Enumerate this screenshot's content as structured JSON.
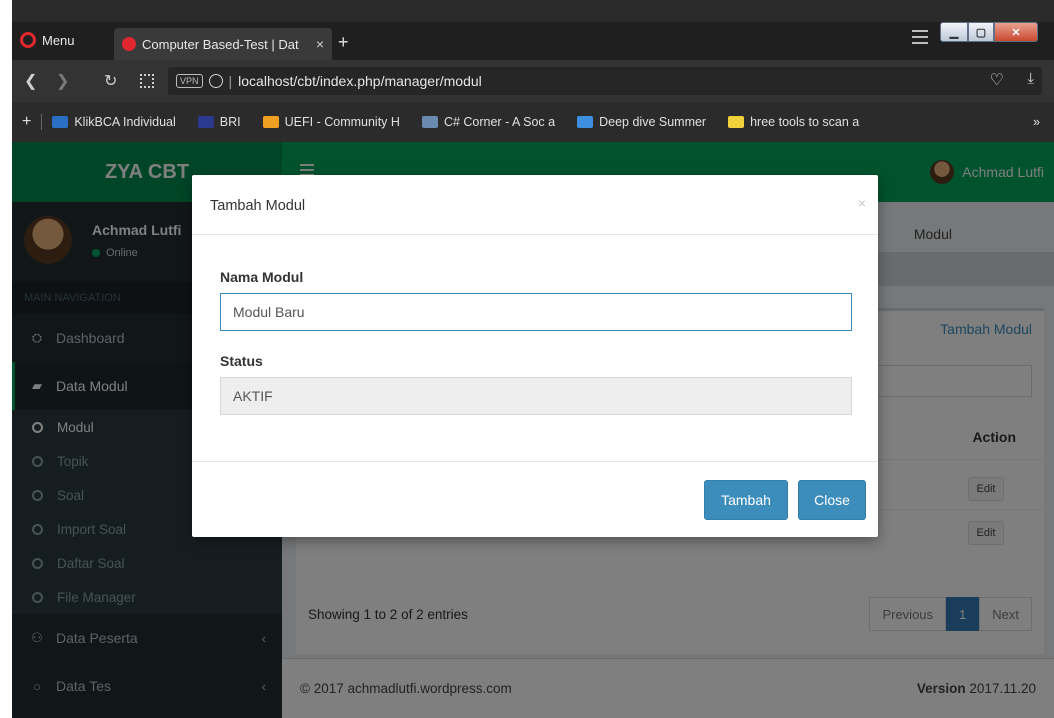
{
  "browser": {
    "menu_label": "Menu",
    "tab_title": "Computer Based-Test | Dat",
    "tab_close": "×",
    "new_tab": "+",
    "url": "localhost/cbt/index.php/manager/modul",
    "vpn_label": "VPN"
  },
  "bookmarks": [
    {
      "label": "KlikBCA Individual",
      "color": "#2b6fc2"
    },
    {
      "label": "BRI",
      "color": "#2b3a8f"
    },
    {
      "label": "UEFI - Community H",
      "color": "#f0a020"
    },
    {
      "label": "C# Corner - A Soc a",
      "color": "#6a8ab0"
    },
    {
      "label": "Deep dive Summer",
      "color": "#3d8fe0"
    },
    {
      "label": "hree tools to scan a",
      "color": "#f2d23c"
    }
  ],
  "bookmarks_more": "»",
  "app": {
    "brand": "ZYA CBT",
    "user_name": "Achmad Lutfi",
    "user_status": "Online",
    "nav_header": "MAIN NAVIGATION",
    "nav_items": [
      {
        "label": "Dashboard",
        "icon": "dashboard-icon",
        "glyph": "⛭"
      },
      {
        "label": "Data Modul",
        "icon": "book-icon",
        "glyph": "▰"
      },
      {
        "label": "Data Peserta",
        "icon": "users-icon",
        "glyph": "⚇"
      },
      {
        "label": "Data Tes",
        "icon": "circle-icon",
        "glyph": "○"
      }
    ],
    "sub_items": [
      "Modul",
      "Topik",
      "Soal",
      "Import Soal",
      "Daftar Soal",
      "File Manager"
    ],
    "top_user": "Achmad Lutfi",
    "breadcrumb": "Modul",
    "box_link": "Tambah Modul",
    "table_header_action": "Action",
    "edit_label": "Edit",
    "info": "Showing 1 to 2 of 2 entries",
    "pagination": [
      "Previous",
      "1",
      "Next"
    ],
    "footer_left": "© 2017 achmadlutfi.wordpress.com",
    "footer_version_label": "Version",
    "footer_version": "2017.11.20"
  },
  "modal": {
    "title": "Tambah Modul",
    "close": "×",
    "name_label": "Nama Modul",
    "name_value": "Modul Baru",
    "status_label": "Status",
    "status_value": "AKTIF",
    "submit_label": "Tambah",
    "close_label": "Close"
  },
  "colors": {
    "brand_green": "#008d4c",
    "header_green": "#00a65a",
    "sidebar_bg": "#222d32",
    "primary_blue": "#3c8dbc"
  }
}
